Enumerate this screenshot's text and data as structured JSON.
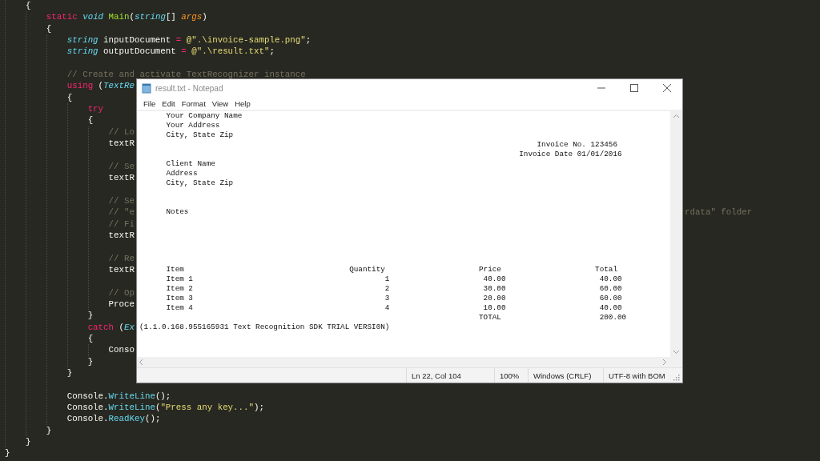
{
  "editor": {
    "code_lines": [
      {
        "children": [
          {
            "tokens": [
              {
                "kind": "plain",
                "text": "{"
              }
            ],
            "children": [
              {
                "tokens": [
                  {
                    "kind": "keyword",
                    "text": "static "
                  },
                  {
                    "kind": "type",
                    "text": "void "
                  },
                  {
                    "kind": "function",
                    "text": "Main"
                  },
                  {
                    "kind": "plain",
                    "text": "("
                  },
                  {
                    "kind": "type",
                    "text": "string"
                  },
                  {
                    "kind": "plain",
                    "text": "[] "
                  },
                  {
                    "kind": "parameter",
                    "text": "args"
                  },
                  {
                    "kind": "plain",
                    "text": ")"
                  }
                ]
              },
              {
                "tokens": [
                  {
                    "kind": "plain",
                    "text": "{"
                  }
                ],
                "children": [
                  {
                    "tokens": [
                      {
                        "kind": "type",
                        "text": "string "
                      },
                      {
                        "kind": "plain",
                        "text": "inputDocument "
                      },
                      {
                        "kind": "operator",
                        "text": "= "
                      },
                      {
                        "kind": "string",
                        "text": "@\".\\invoice-sample.png\""
                      },
                      {
                        "kind": "plain",
                        "text": ";"
                      }
                    ]
                  },
                  {
                    "tokens": [
                      {
                        "kind": "type",
                        "text": "string "
                      },
                      {
                        "kind": "plain",
                        "text": "outputDocument "
                      },
                      {
                        "kind": "operator",
                        "text": "= "
                      },
                      {
                        "kind": "string",
                        "text": "@\".\\result.txt\""
                      },
                      {
                        "kind": "plain",
                        "text": ";"
                      }
                    ]
                  },
                  {
                    "kind": "blank"
                  },
                  {
                    "tokens": [
                      {
                        "kind": "comment",
                        "text": "// Create and activate TextRecognizer instance"
                      }
                    ]
                  },
                  {
                    "tokens": [
                      {
                        "kind": "keyword",
                        "text": "using "
                      },
                      {
                        "kind": "plain",
                        "text": "("
                      },
                      {
                        "kind": "type",
                        "text": "TextRe"
                      }
                    ]
                  },
                  {
                    "tokens": [
                      {
                        "kind": "plain",
                        "text": "{"
                      }
                    ],
                    "children": [
                      {
                        "tokens": [
                          {
                            "kind": "keyword",
                            "text": "try"
                          }
                        ]
                      },
                      {
                        "tokens": [
                          {
                            "kind": "plain",
                            "text": "{"
                          }
                        ],
                        "children": [
                          {
                            "tokens": [
                              {
                                "kind": "comment",
                                "text": "// Lo"
                              }
                            ]
                          },
                          {
                            "tokens": [
                              {
                                "kind": "plain",
                                "text": "textR"
                              }
                            ]
                          },
                          {
                            "kind": "blank"
                          },
                          {
                            "tokens": [
                              {
                                "kind": "comment",
                                "text": "// Se"
                              }
                            ]
                          },
                          {
                            "tokens": [
                              {
                                "kind": "plain",
                                "text": "textR"
                              }
                            ]
                          },
                          {
                            "kind": "blank"
                          },
                          {
                            "tokens": [
                              {
                                "kind": "comment",
                                "text": "// Se"
                              }
                            ]
                          },
                          {
                            "tokens": [
                              {
                                "kind": "comment",
                                "text": "// \"e"
                              }
                            ],
                            "tail": [
                              {
                                "kind": "comment",
                                "text": "rdata\" folder"
                              }
                            ]
                          },
                          {
                            "tokens": [
                              {
                                "kind": "comment",
                                "text": "// Fi"
                              }
                            ]
                          },
                          {
                            "tokens": [
                              {
                                "kind": "plain",
                                "text": "textR"
                              }
                            ]
                          },
                          {
                            "kind": "blank"
                          },
                          {
                            "tokens": [
                              {
                                "kind": "comment",
                                "text": "// Re"
                              }
                            ]
                          },
                          {
                            "tokens": [
                              {
                                "kind": "plain",
                                "text": "textR"
                              }
                            ]
                          },
                          {
                            "kind": "blank"
                          },
                          {
                            "tokens": [
                              {
                                "kind": "comment",
                                "text": "// Op"
                              }
                            ]
                          },
                          {
                            "tokens": [
                              {
                                "kind": "plain",
                                "text": "Proce"
                              }
                            ]
                          }
                        ]
                      },
                      {
                        "tokens": [
                          {
                            "kind": "plain",
                            "text": "}"
                          }
                        ]
                      },
                      {
                        "tokens": [
                          {
                            "kind": "keyword",
                            "text": "catch "
                          },
                          {
                            "kind": "plain",
                            "text": "("
                          },
                          {
                            "kind": "type",
                            "text": "Ex"
                          }
                        ]
                      },
                      {
                        "tokens": [
                          {
                            "kind": "plain",
                            "text": "{"
                          }
                        ],
                        "children": [
                          {
                            "tokens": [
                              {
                                "kind": "plain",
                                "text": "Conso"
                              }
                            ]
                          }
                        ]
                      },
                      {
                        "tokens": [
                          {
                            "kind": "plain",
                            "text": "}"
                          }
                        ]
                      }
                    ]
                  },
                  {
                    "tokens": [
                      {
                        "kind": "plain",
                        "text": "}"
                      }
                    ]
                  },
                  {
                    "kind": "blank"
                  },
                  {
                    "tokens": [
                      {
                        "kind": "plain",
                        "text": "Console."
                      },
                      {
                        "kind": "method",
                        "text": "WriteLine"
                      },
                      {
                        "kind": "plain",
                        "text": "();"
                      }
                    ]
                  },
                  {
                    "tokens": [
                      {
                        "kind": "plain",
                        "text": "Console."
                      },
                      {
                        "kind": "method",
                        "text": "WriteLine"
                      },
                      {
                        "kind": "plain",
                        "text": "("
                      },
                      {
                        "kind": "string",
                        "text": "\"Press any key...\""
                      },
                      {
                        "kind": "plain",
                        "text": ");"
                      }
                    ]
                  },
                  {
                    "tokens": [
                      {
                        "kind": "plain",
                        "text": "Console."
                      },
                      {
                        "kind": "method",
                        "text": "ReadKey"
                      },
                      {
                        "kind": "plain",
                        "text": "();"
                      }
                    ]
                  }
                ]
              },
              {
                "tokens": [
                  {
                    "kind": "plain",
                    "text": "}"
                  }
                ]
              }
            ]
          },
          {
            "tokens": [
              {
                "kind": "plain",
                "text": "}"
              }
            ]
          }
        ]
      },
      {
        "tokens": [
          {
            "kind": "plain",
            "text": "}"
          }
        ]
      }
    ]
  },
  "notepad": {
    "title": "result.txt - Notepad",
    "menu": [
      "File",
      "Edit",
      "Format",
      "View",
      "Help"
    ],
    "lines": [
      {
        "kind": "text",
        "text": "      Your Company Name"
      },
      {
        "kind": "text",
        "text": "      Your Address"
      },
      {
        "kind": "text",
        "text": "      City, State Zip"
      },
      {
        "kind": "text",
        "text": "                                                                                         Invoice No. 123456"
      },
      {
        "kind": "text",
        "text": "                                                                                     Invoice Date 01/01/2016"
      },
      {
        "kind": "text",
        "text": "      Client Name"
      },
      {
        "kind": "text",
        "text": "      Address"
      },
      {
        "kind": "text",
        "text": "      City, State Zip"
      },
      {
        "kind": "blank"
      },
      {
        "kind": "blank"
      },
      {
        "kind": "text",
        "text": "      Notes"
      },
      {
        "kind": "blank"
      },
      {
        "kind": "blank"
      },
      {
        "kind": "blank"
      },
      {
        "kind": "blank"
      },
      {
        "kind": "blank"
      },
      {
        "kind": "text",
        "text": "      Item                                     Quantity                     Price                     Total"
      },
      {
        "kind": "text",
        "text": "      Item 1                                           1                     40.00                     40.00"
      },
      {
        "kind": "text",
        "text": "      Item 2                                           2                     30.00                     60.00"
      },
      {
        "kind": "text",
        "text": "      Item 3                                           3                     20.00                     60.00"
      },
      {
        "kind": "text",
        "text": "      Item 4                                           4                     10.00                     40.00"
      },
      {
        "kind": "text",
        "text": "                                                                            TOTAL                      200.00"
      },
      {
        "kind": "text",
        "text": "(1.1.0.168.955165931 Text Recognition SDK TRIAL VERSI0N)"
      }
    ],
    "status_bar": [
      "Ln 22, Col 104",
      "100%",
      "Windows (CRLF)",
      "UTF-8 with BOM"
    ]
  }
}
